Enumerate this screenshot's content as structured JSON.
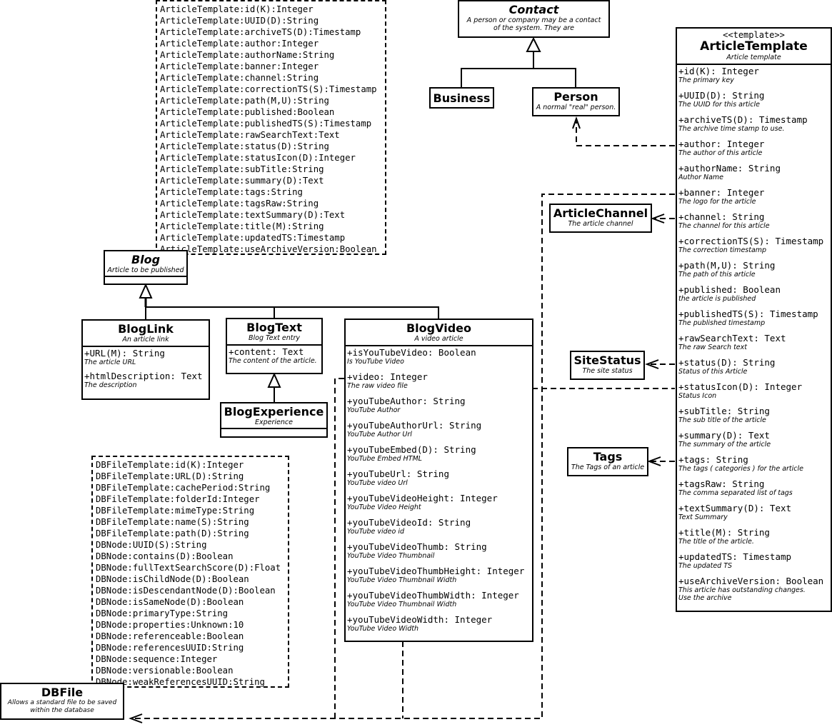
{
  "diagram": {
    "type": "UML class diagram",
    "notes": {
      "article_template_props": [
        "ArticleTemplate:id(K):Integer",
        "ArticleTemplate:UUID(D):String",
        "ArticleTemplate:archiveTS(D):Timestamp",
        "ArticleTemplate:author:Integer",
        "ArticleTemplate:authorName:String",
        "ArticleTemplate:banner:Integer",
        "ArticleTemplate:channel:String",
        "ArticleTemplate:correctionTS(S):Timestamp",
        "ArticleTemplate:path(M,U):String",
        "ArticleTemplate:published:Boolean",
        "ArticleTemplate:publishedTS(S):Timestamp",
        "ArticleTemplate:rawSearchText:Text",
        "ArticleTemplate:status(D):String",
        "ArticleTemplate:statusIcon(D):Integer",
        "ArticleTemplate:subTitle:String",
        "ArticleTemplate:summary(D):Text",
        "ArticleTemplate:tags:String",
        "ArticleTemplate:tagsRaw:String",
        "ArticleTemplate:textSummary(D):Text",
        "ArticleTemplate:title(M):String",
        "ArticleTemplate:updatedTS:Timestamp",
        "ArticleTemplate:useArchiveVersion:Boolean"
      ],
      "dbfile_props": [
        "DBFileTemplate:id(K):Integer",
        "DBFileTemplate:URL(D):String",
        "DBFileTemplate:cachePeriod:String",
        "DBFileTemplate:folderId:Integer",
        "DBFileTemplate:mimeType:String",
        "DBFileTemplate:name(S):String",
        "DBFileTemplate:path(D):String",
        "DBNode:UUID(S):String",
        "DBNode:contains(D):Boolean",
        "DBNode:fullTextSearchScore(D):Float",
        "DBNode:isChildNode(D):Boolean",
        "DBNode:isDescendantNode(D):Boolean",
        "DBNode:isSameNode(D):Boolean",
        "DBNode:primaryType:String",
        "DBNode:properties:Unknown:10",
        "DBNode:referenceable:Boolean",
        "DBNode:referencesUUID:String",
        "DBNode:sequence:Integer",
        "DBNode:versionable:Boolean",
        "DBNode:weakReferencesUUID:String"
      ]
    },
    "classes": {
      "contact": {
        "name": "Contact",
        "desc": "A person or company may be a contact of the system. They are"
      },
      "business": {
        "name": "Business"
      },
      "person": {
        "name": "Person",
        "desc": "A normal \"real\" person."
      },
      "blog": {
        "name": "Blog",
        "desc": "Article to be published"
      },
      "bloglink": {
        "name": "BlogLink",
        "desc": "An article link",
        "attrs": [
          {
            "sig": "+URL(M): String",
            "note": "The article URL"
          },
          {
            "sig": "+htmlDescription: Text",
            "note": "The description"
          }
        ]
      },
      "blogtext": {
        "name": "BlogText",
        "desc": "Blog Text entry",
        "attrs": [
          {
            "sig": "+content: Text",
            "note": "The content of the article."
          }
        ]
      },
      "blogexperience": {
        "name": "BlogExperience",
        "desc": "Experience"
      },
      "blogvideo": {
        "name": "BlogVideo",
        "desc": "A video article",
        "attrs": [
          {
            "sig": "+isYouTubeVideo: Boolean",
            "note": "Is YouTube Video"
          },
          {
            "sig": "+video: Integer",
            "note": "The raw video file"
          },
          {
            "sig": "+youTubeAuthor: String",
            "note": "YouTube Author"
          },
          {
            "sig": "+youTubeAuthorUrl: String",
            "note": "YouTube Author Url"
          },
          {
            "sig": "+youTubeEmbed(D): String",
            "note": "YouTube Embed HTML"
          },
          {
            "sig": "+youTubeUrl: String",
            "note": "YouTube video Url"
          },
          {
            "sig": "+youTubeVideoHeight: Integer",
            "note": "YouTube Video Height"
          },
          {
            "sig": "+youTubeVideoId: String",
            "note": "YouTube video id"
          },
          {
            "sig": "+youTubeVideoThumb: String",
            "note": "YouTube Video Thumbnail"
          },
          {
            "sig": "+youTubeVideoThumbHeight: Integer",
            "note": "YouTube Video Thumbnail Width"
          },
          {
            "sig": "+youTubeVideoThumbWidth: Integer",
            "note": "YouTube Video Thumbnail Width"
          },
          {
            "sig": "+youTubeVideoWidth: Integer",
            "note": "YouTube Video Width"
          }
        ]
      },
      "articlechannel": {
        "name": "ArticleChannel",
        "desc": "The article channel"
      },
      "sitestatus": {
        "name": "SiteStatus",
        "desc": "The site status"
      },
      "tags": {
        "name": "Tags",
        "desc": "The Tags of an article"
      },
      "dbfile": {
        "name": "DBFile",
        "desc": "Allows a standard file to be saved within the database"
      },
      "articletemplate": {
        "stereotype": "<<template>>",
        "name": "ArticleTemplate",
        "desc": "Article template",
        "attrs": [
          {
            "sig": "+id(K): Integer",
            "note": "The primary key"
          },
          {
            "sig": "+UUID(D): String",
            "note": "The UUID for this article"
          },
          {
            "sig": "+archiveTS(D): Timestamp",
            "note": "The archive time stamp to use."
          },
          {
            "sig": "+author: Integer",
            "note": "The author of this article"
          },
          {
            "sig": "+authorName: String",
            "note": "Author Name"
          },
          {
            "sig": "+banner: Integer",
            "note": "The logo for the article"
          },
          {
            "sig": "+channel: String",
            "note": "The channel for this article"
          },
          {
            "sig": "+correctionTS(S): Timestamp",
            "note": "The correction timestamp"
          },
          {
            "sig": "+path(M,U): String",
            "note": "The path of this article"
          },
          {
            "sig": "+published: Boolean",
            "note": "the article is published"
          },
          {
            "sig": "+publishedTS(S): Timestamp",
            "note": "The published timestamp"
          },
          {
            "sig": "+rawSearchText: Text",
            "note": "The raw Search text"
          },
          {
            "sig": "+status(D): String",
            "note": "Status of this Article"
          },
          {
            "sig": "+statusIcon(D): Integer",
            "note": "Status Icon"
          },
          {
            "sig": "+subTitle: String",
            "note": "The sub title of the article"
          },
          {
            "sig": "+summary(D): Text",
            "note": "The summary of the article"
          },
          {
            "sig": "+tags: String",
            "note": "The tags ( categories ) for the article"
          },
          {
            "sig": "+tagsRaw: String",
            "note": "The comma separated list of tags"
          },
          {
            "sig": "+textSummary(D): Text",
            "note": "Text Summary"
          },
          {
            "sig": "+title(M): String",
            "note": "The title of the article."
          },
          {
            "sig": "+updatedTS: Timestamp",
            "note": "The updated TS"
          },
          {
            "sig": "+useArchiveVersion: Boolean",
            "note": "This article has outstanding changes.\nUse the archive"
          }
        ]
      }
    }
  }
}
